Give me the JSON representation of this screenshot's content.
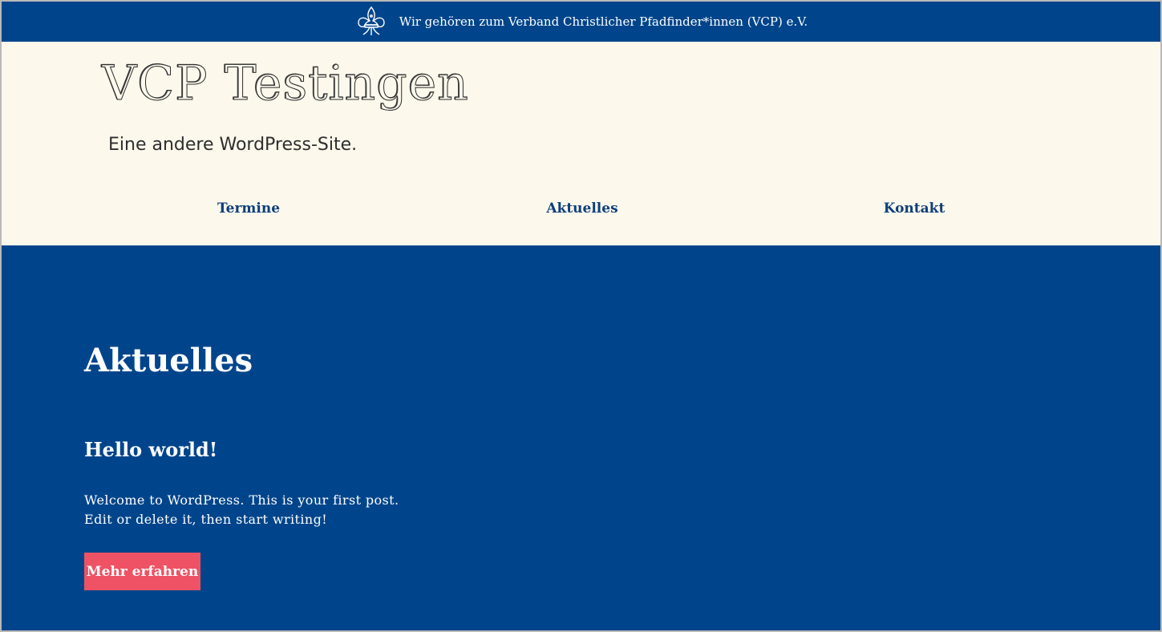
{
  "topbar": {
    "icon": "fleur-de-lis-icon",
    "text": "Wir gehören zum Verband Christlicher Pfadfinder*innen (VCP) e.V."
  },
  "header": {
    "site_title": "VCP Testingen",
    "tagline": "Eine andere WordPress-Site."
  },
  "nav": {
    "items": [
      {
        "label": "Termine"
      },
      {
        "label": "Aktuelles"
      },
      {
        "label": "Kontakt"
      }
    ]
  },
  "main": {
    "page_title": "Aktuelles",
    "post": {
      "title": "Hello world!",
      "excerpt_line1": "Welcome to WordPress. This is your first post.",
      "excerpt_line2": "Edit or delete it, then start writing!",
      "button_label": "Mehr erfahren"
    }
  },
  "colors": {
    "primary": "#00458b",
    "header_bg": "#fcf8ec",
    "nav_text": "#0e3f7b",
    "button": "#ef5264"
  }
}
